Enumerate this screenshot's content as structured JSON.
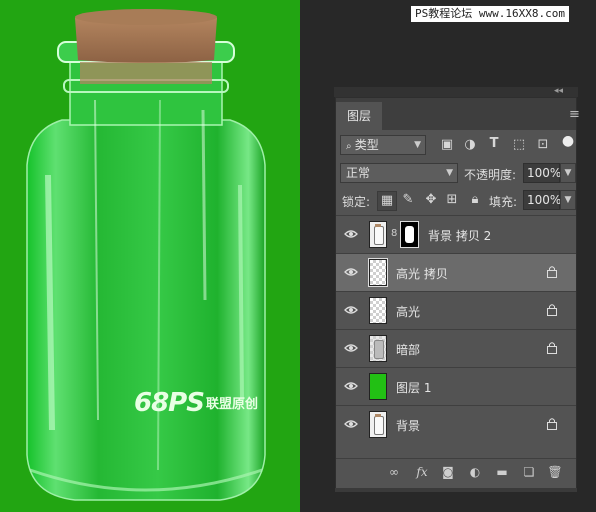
{
  "watermark": {
    "text": "PS教程论坛 www.16XX8.com"
  },
  "brand": {
    "big": "68PS",
    "small": "联盟原创"
  },
  "panel": {
    "collapse_glyph": "◂◂",
    "tab_label": "图层",
    "menu_glyph": "≡",
    "filter": {
      "value": "类型",
      "icon": "search-icon"
    },
    "filter_icons": [
      "image-filter-icon",
      "adjustment-filter-icon",
      "type-filter-icon",
      "shape-filter-icon",
      "smart-object-filter-icon",
      "filter-toggle-icon"
    ],
    "blend_mode": "正常",
    "opacity_label": "不透明度:",
    "opacity_value": "100%",
    "lock_label": "锁定:",
    "fill_label": "填充:",
    "fill_value": "100%",
    "layers": [
      {
        "name": "背景 拷贝 2",
        "visible": true,
        "locked": false,
        "selected": false,
        "thumb": "photo",
        "has_mask": true
      },
      {
        "name": "高光 拷贝",
        "visible": true,
        "locked": true,
        "selected": true,
        "thumb": "transparent",
        "has_mask": false
      },
      {
        "name": "高光",
        "visible": true,
        "locked": true,
        "selected": false,
        "thumb": "transparent",
        "has_mask": false
      },
      {
        "name": "暗部",
        "visible": true,
        "locked": true,
        "selected": false,
        "thumb": "dark",
        "has_mask": false
      },
      {
        "name": "图层 1",
        "visible": true,
        "locked": false,
        "selected": false,
        "thumb": "green",
        "has_mask": false
      },
      {
        "name": "背景",
        "visible": true,
        "locked": true,
        "selected": false,
        "thumb": "photo",
        "has_mask": false
      }
    ],
    "bottom_buttons": [
      {
        "name": "link-layers-button",
        "glyph": "∞"
      },
      {
        "name": "fx-button",
        "glyph": "fx"
      },
      {
        "name": "add-mask-button",
        "glyph": "◙"
      },
      {
        "name": "adjustment-layer-button",
        "glyph": "◐"
      },
      {
        "name": "new-group-button",
        "glyph": "▬"
      },
      {
        "name": "new-layer-button",
        "glyph": "❏"
      },
      {
        "name": "delete-layer-button",
        "glyph": "🗑"
      }
    ]
  },
  "colors": {
    "canvas_green": "#22a512",
    "panel_bg": "#535353",
    "selected_row": "#6b6b6b"
  }
}
